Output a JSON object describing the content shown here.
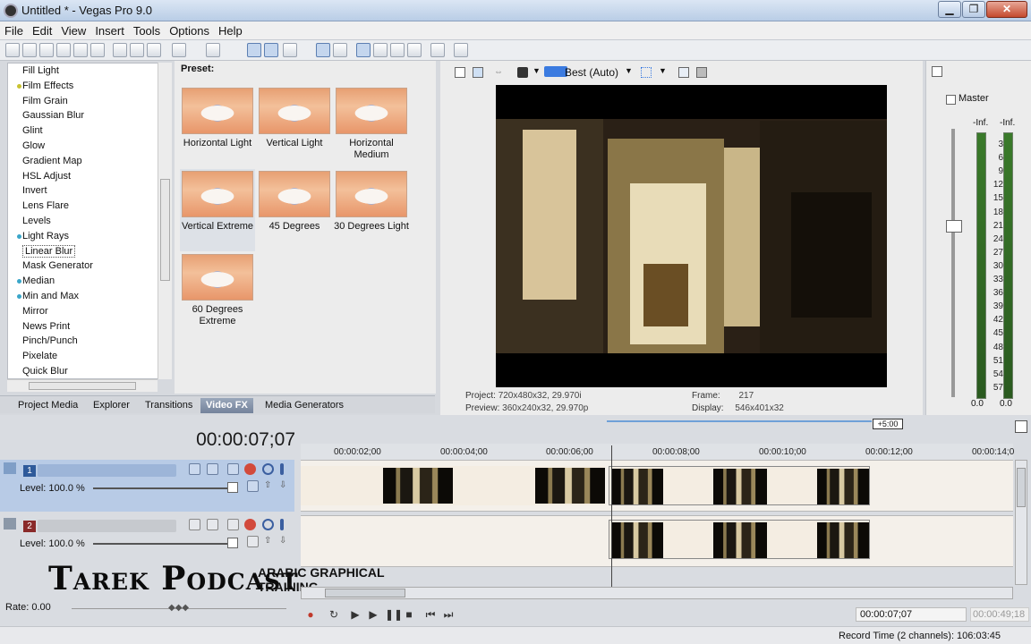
{
  "window": {
    "title": "Untitled * - Vegas Pro 9.0",
    "minimize": "▁",
    "maximize": "❐",
    "close": "✕"
  },
  "menu": [
    "File",
    "Edit",
    "View",
    "Insert",
    "Tools",
    "Options",
    "Help"
  ],
  "fx_list": {
    "items": [
      {
        "label": "Fill Light",
        "dot": ""
      },
      {
        "label": "Film Effects",
        "dot": "#c9c230"
      },
      {
        "label": "Film Grain",
        "dot": ""
      },
      {
        "label": "Gaussian Blur",
        "dot": ""
      },
      {
        "label": "Glint",
        "dot": ""
      },
      {
        "label": "Glow",
        "dot": ""
      },
      {
        "label": "Gradient Map",
        "dot": ""
      },
      {
        "label": "HSL Adjust",
        "dot": ""
      },
      {
        "label": "Invert",
        "dot": ""
      },
      {
        "label": "Lens Flare",
        "dot": ""
      },
      {
        "label": "Levels",
        "dot": ""
      },
      {
        "label": "Light Rays",
        "dot": "#3aa6c9"
      },
      {
        "label": "Linear Blur",
        "dot": "",
        "selected": true
      },
      {
        "label": "Mask Generator",
        "dot": ""
      },
      {
        "label": "Median",
        "dot": "#3aa6c9"
      },
      {
        "label": "Min and Max",
        "dot": "#3aa6c9"
      },
      {
        "label": "Mirror",
        "dot": ""
      },
      {
        "label": "News Print",
        "dot": ""
      },
      {
        "label": "Pinch/Punch",
        "dot": ""
      },
      {
        "label": "Pixelate",
        "dot": ""
      },
      {
        "label": "Quick Blur",
        "dot": ""
      }
    ]
  },
  "presets": {
    "label": "Preset:",
    "items": [
      "Horizontal Light",
      "Vertical Light",
      "Horizontal Medium",
      "Vertical Extreme",
      "45 Degrees",
      "30 Degrees Light",
      "60 Degrees Extreme"
    ]
  },
  "tabs": [
    "Project Media",
    "Explorer",
    "Transitions",
    "Video FX",
    "Media Generators"
  ],
  "preview": {
    "quality": "Best (Auto)",
    "project_label": "Project:",
    "project_value": "720x480x32, 29.970i",
    "preview_label": "Preview:",
    "preview_value": "360x240x32, 29.970p",
    "frame_label": "Frame:",
    "frame_value": "217",
    "display_label": "Display:",
    "display_value": "546x401x32"
  },
  "master": {
    "label": "Master",
    "left_inf": "-Inf.",
    "right_inf": "-Inf.",
    "scale": [
      "3",
      "6",
      "9",
      "12",
      "15",
      "18",
      "21",
      "24",
      "27",
      "30",
      "33",
      "36",
      "39",
      "42",
      "45",
      "48",
      "51",
      "54",
      "57"
    ],
    "left_value": "0.0",
    "right_value": "0.0",
    "meter_level": 0
  },
  "timeline": {
    "timecode": "00:00:07;07",
    "ruler_ticks": [
      "00:00:02;00",
      "00:00:04;00",
      "00:00:06;00",
      "00:00:08;00",
      "00:00:10;00",
      "00:00:12;00",
      "00:00:14;0"
    ],
    "region_badge": "+5:00",
    "tracks": [
      {
        "num": "1",
        "level": "Level: 100.0 %"
      },
      {
        "num": "2",
        "level": "Level: 100.0 %"
      }
    ],
    "rate": "Rate: 0.00",
    "position": "00:00:07;07",
    "end": "00:00:49;18",
    "record_time": "Record Time (2 channels): 106:03:45"
  },
  "watermark": {
    "main": "Tarek Podcast",
    "sub1": "ARABIC GRAPHICAL",
    "sub2": "TRAINING"
  }
}
